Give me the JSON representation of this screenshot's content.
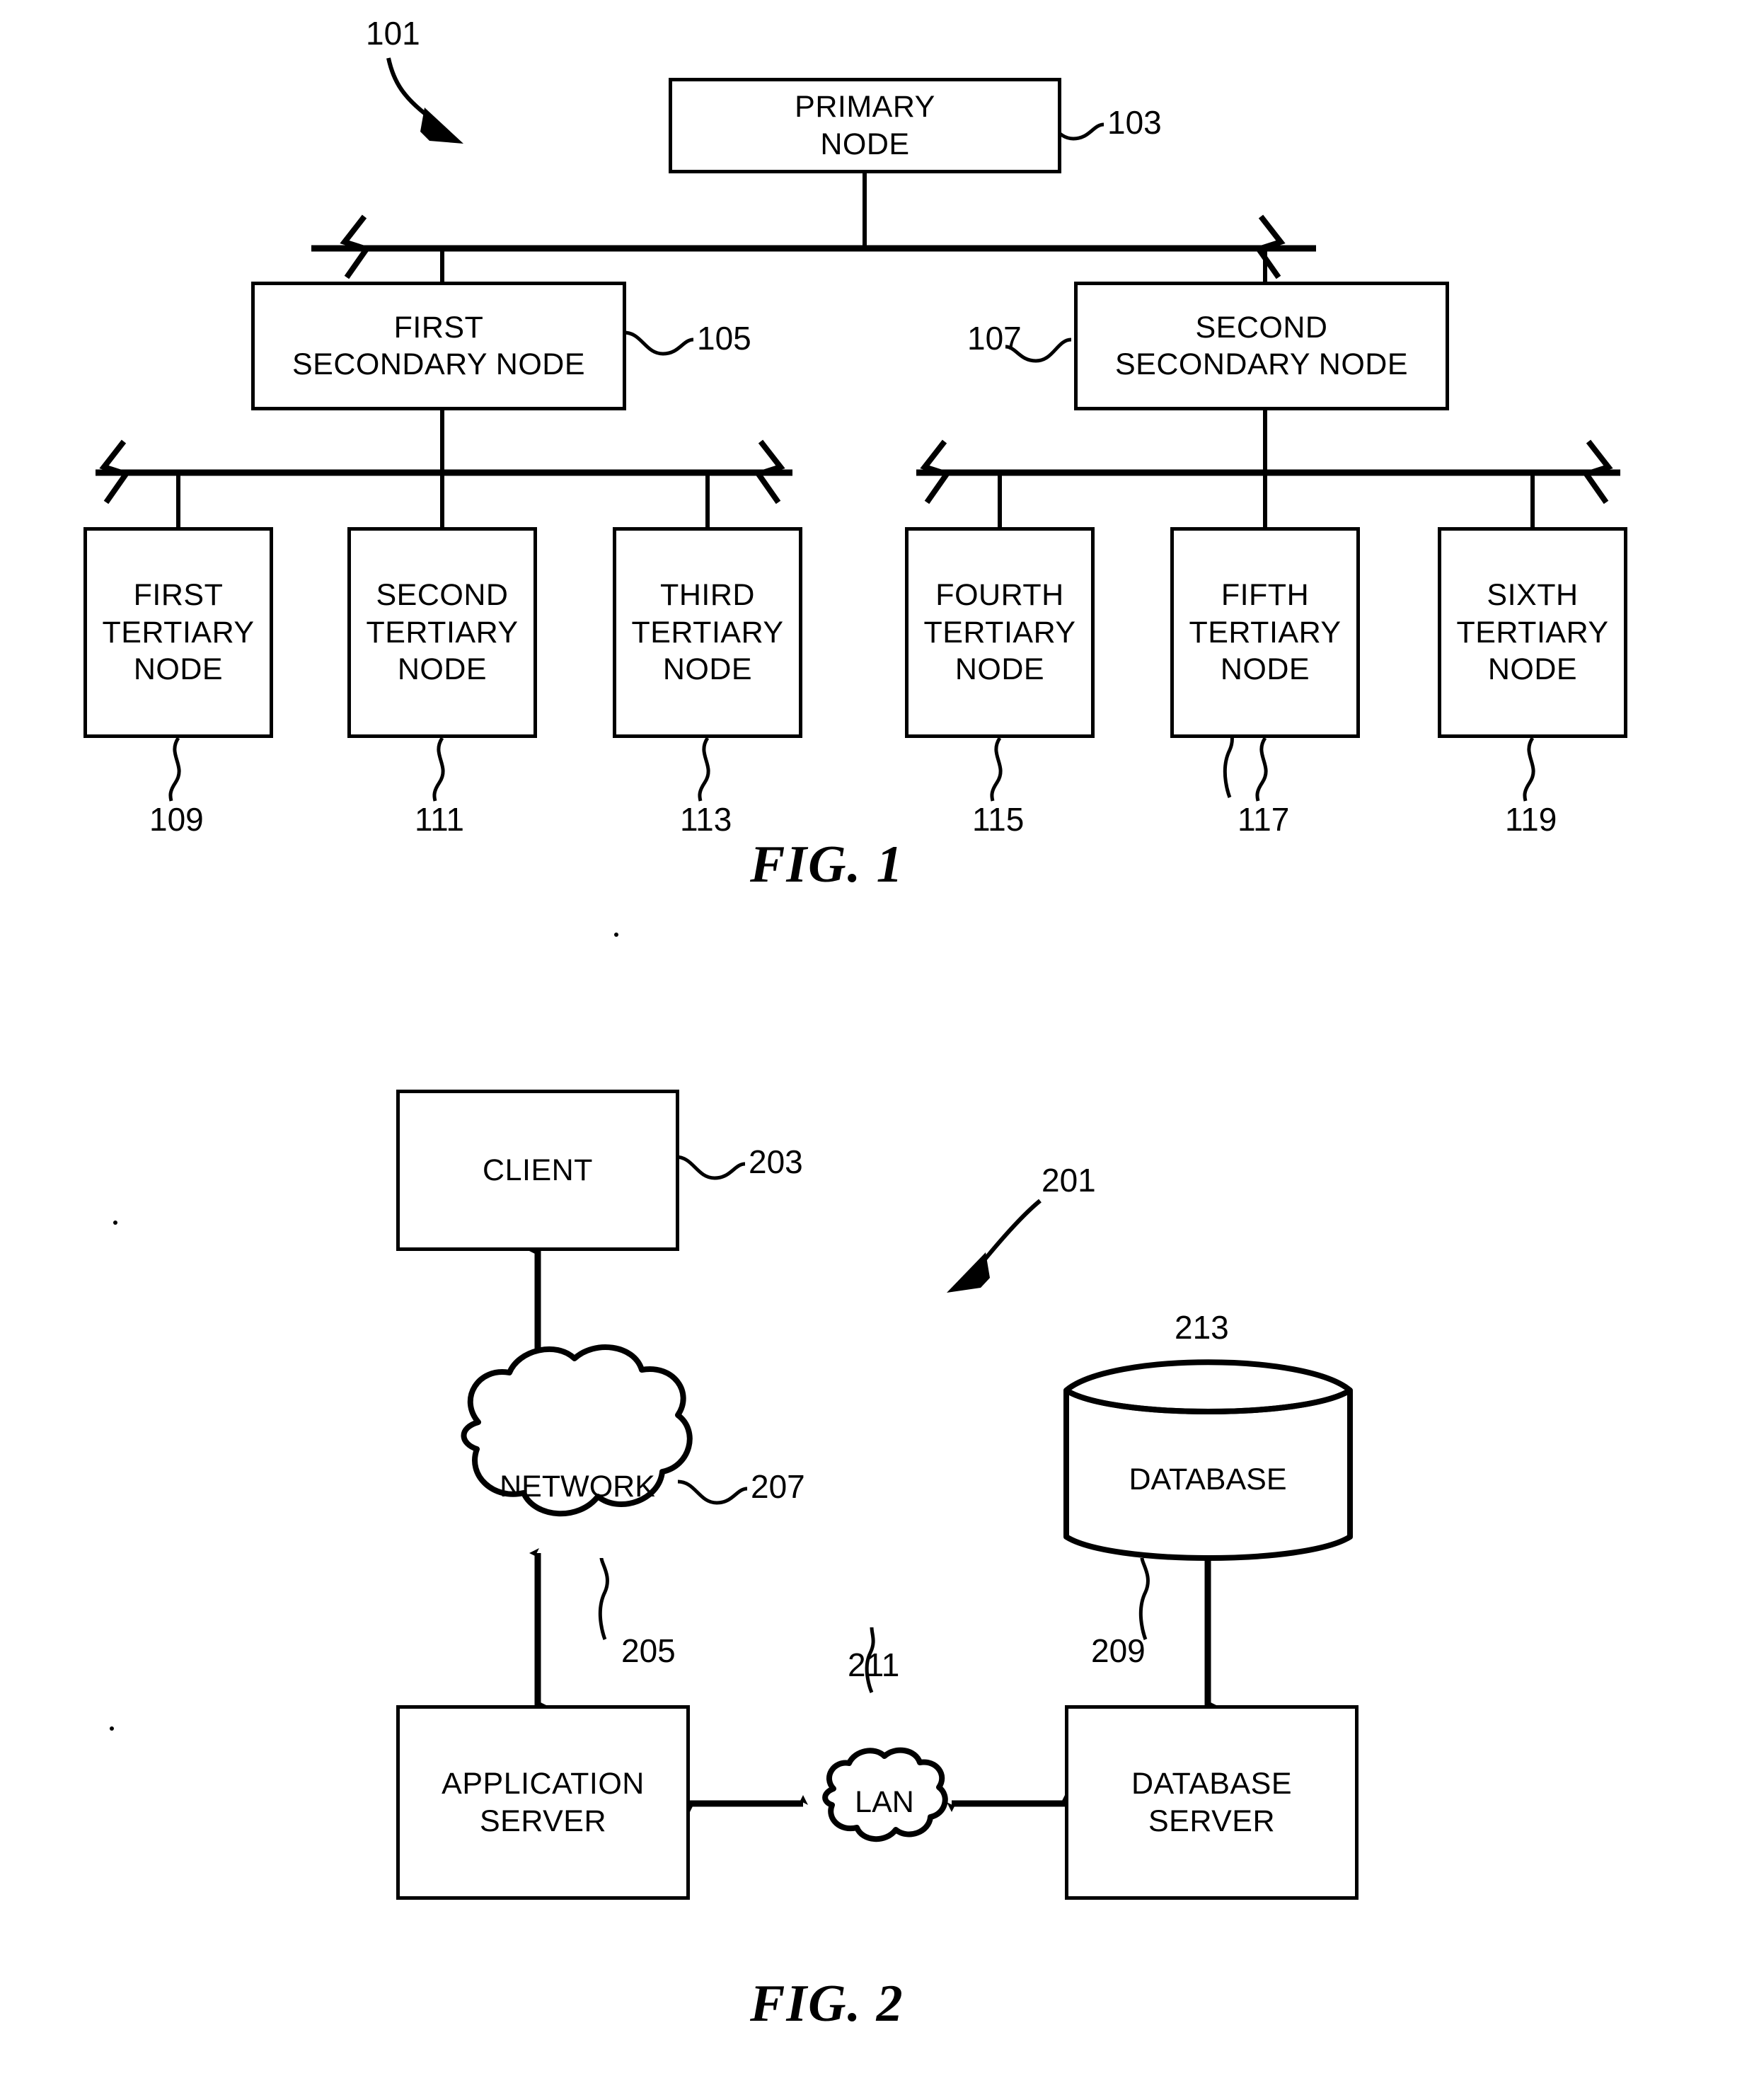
{
  "document": {
    "type": "patent-figure-sheet",
    "figures": [
      "FIG. 1",
      "FIG. 2"
    ]
  },
  "figure1": {
    "caption": "FIG. 1",
    "system_ref": "101",
    "nodes": {
      "primary": {
        "label": "PRIMARY\nNODE",
        "ref": "103"
      },
      "secondary": [
        {
          "label": "FIRST\nSECONDARY NODE",
          "ref": "105"
        },
        {
          "label": "SECOND\nSECONDARY NODE",
          "ref": "107"
        }
      ],
      "tertiary": [
        {
          "label": "FIRST\nTERTIARY\nNODE",
          "ref": "109"
        },
        {
          "label": "SECOND\nTERTIARY\nNODE",
          "ref": "111"
        },
        {
          "label": "THIRD\nTERTIARY\nNODE",
          "ref": "113"
        },
        {
          "label": "FOURTH\nTERTIARY\nNODE",
          "ref": "115"
        },
        {
          "label": "FIFTH\nTERTIARY\nNODE",
          "ref": "117"
        },
        {
          "label": "SIXTH\nTERTIARY\nNODE",
          "ref": "119"
        }
      ]
    }
  },
  "figure2": {
    "caption": "FIG. 2",
    "system_ref": "201",
    "nodes": {
      "client": {
        "label": "CLIENT",
        "ref": "203"
      },
      "network": {
        "label": "NETWORK",
        "ref": "207"
      },
      "application_server": {
        "label": "APPLICATION\nSERVER",
        "ref": "205"
      },
      "lan": {
        "label": "LAN",
        "ref": "211"
      },
      "database_server": {
        "label": "DATABASE\nSERVER",
        "ref": "209"
      },
      "database": {
        "label": "DATABASE",
        "ref": "213"
      }
    }
  },
  "style": {
    "ink": "#000000",
    "paper": "#ffffff"
  }
}
